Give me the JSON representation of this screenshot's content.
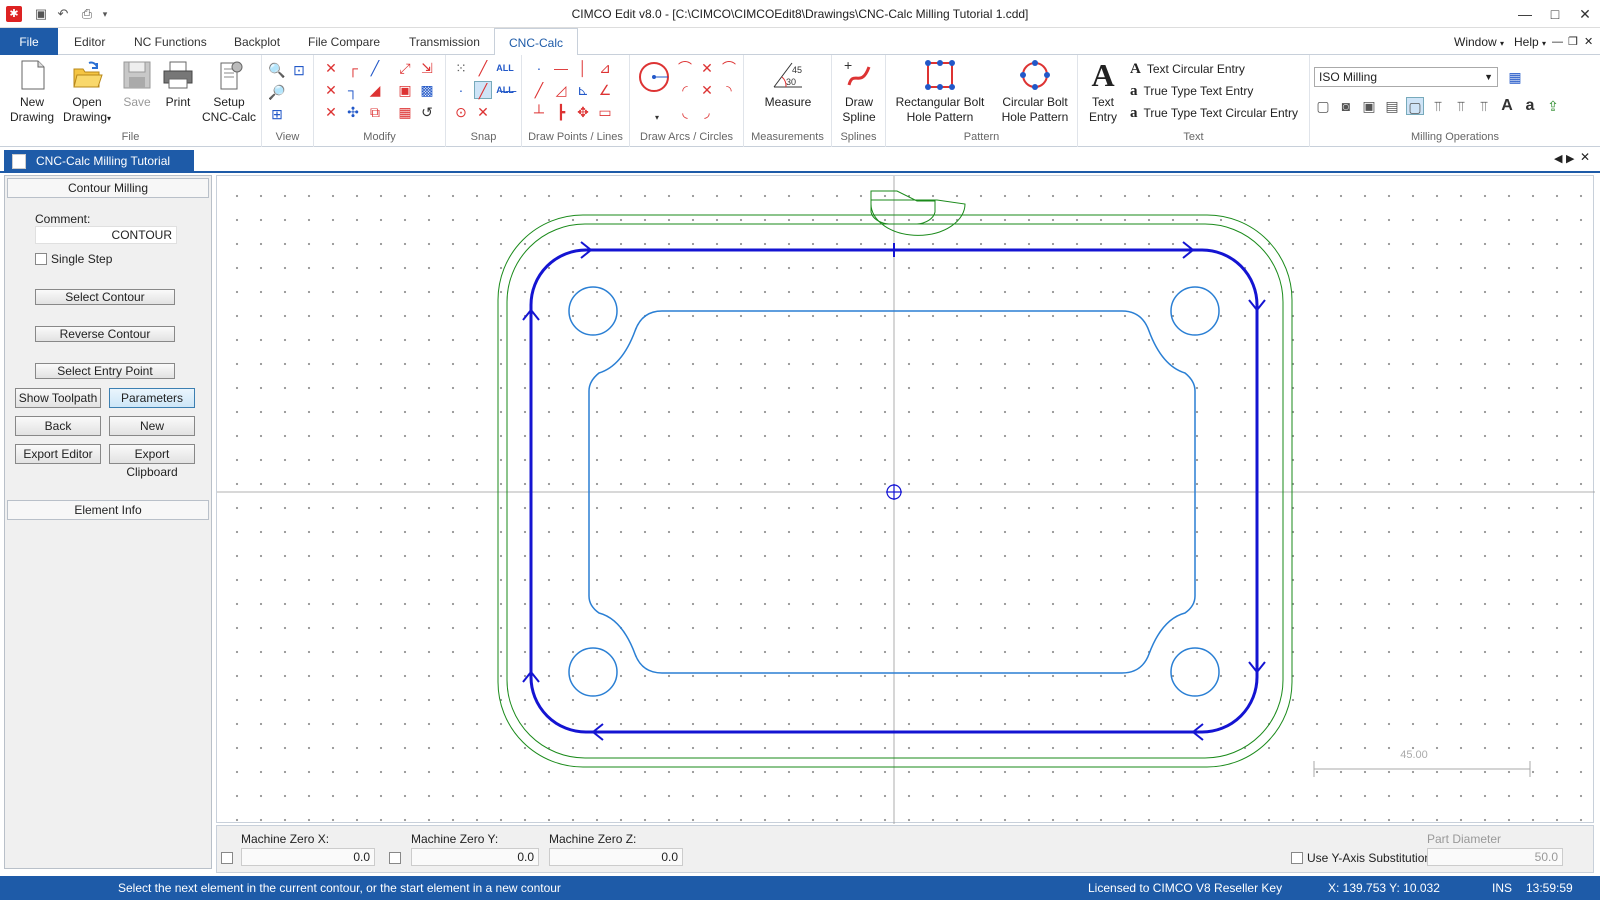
{
  "window": {
    "title": "CIMCO Edit v8.0 - [C:\\CIMCO\\CIMCOEdit8\\Drawings\\CNC-Calc Milling Tutorial 1.cdd]",
    "minimize": "—",
    "maximize": "□",
    "close": "✕"
  },
  "menu": {
    "file": "File",
    "tabs": [
      "Editor",
      "NC Functions",
      "Backplot",
      "File Compare",
      "Transmission",
      "CNC-Calc"
    ],
    "active_tab": "CNC-Calc",
    "window_menu": "Window",
    "help_menu": "Help"
  },
  "ribbon": {
    "file_group": {
      "label": "File",
      "new": [
        "New",
        "Drawing"
      ],
      "open": [
        "Open",
        "Drawing"
      ],
      "save": "Save",
      "print": "Print",
      "setup": [
        "Setup",
        "CNC-Calc"
      ]
    },
    "groups": {
      "view": "View",
      "modify": "Modify",
      "snap": "Snap",
      "draw_points": "Draw Points / Lines",
      "draw_arcs": "Draw Arcs / Circles",
      "measurements": "Measurements",
      "splines": "Splines",
      "pattern": "Pattern",
      "text": "Text",
      "milling": "Milling Operations"
    },
    "measure": "Measure",
    "measure_icon_numbers": [
      "45",
      "30"
    ],
    "draw_spline": [
      "Draw",
      "Spline"
    ],
    "rect_bolt": [
      "Rectangular Bolt",
      "Hole Pattern"
    ],
    "circ_bolt": [
      "Circular Bolt",
      "Hole Pattern"
    ],
    "text_entry": [
      "Text",
      "Entry"
    ],
    "text_items": [
      "Text Circular Entry",
      "True Type Text Entry",
      "True Type Text Circular Entry"
    ],
    "milling_combo": "ISO Milling"
  },
  "document": {
    "tab": "CNC-Calc Milling Tutorial 1.cdd"
  },
  "left_panel": {
    "header": "Contour Milling",
    "comment_label": "Comment:",
    "comment_value": "CONTOUR",
    "single_step": "Single Step",
    "select_contour": "Select Contour",
    "reverse_contour": "Reverse Contour",
    "select_entry": "Select Entry Point",
    "show_toolpath": "Show Toolpath",
    "parameters": "Parameters",
    "back": "Back",
    "new": "New",
    "export_editor": "Export Editor",
    "export_clipboard": "Export Clipboard",
    "element_info": "Element Info"
  },
  "canvas": {
    "scale_label": "45.00"
  },
  "machine_zero": {
    "x_label": "Machine Zero X:",
    "x_value": "0.0",
    "y_label": "Machine Zero Y:",
    "y_value": "0.0",
    "z_label": "Machine Zero Z:",
    "z_value": "0.0",
    "y_axis_sub": "Use Y-Axis Substitution",
    "part_diameter_label": "Part Diameter",
    "part_diameter_value": "50.0"
  },
  "status": {
    "message": "Select the next element in the current contour, or the start element in a new contour",
    "license": "Licensed to CIMCO V8 Reseller Key",
    "coords": "X: 139.753 Y: 10.032",
    "mode": "INS",
    "time": "13:59:59"
  },
  "colors": {
    "accent": "#1e5ba8",
    "toolpath": "#1414d2",
    "geometry": "#2a7fd4",
    "stock": "#1a8a1a"
  }
}
